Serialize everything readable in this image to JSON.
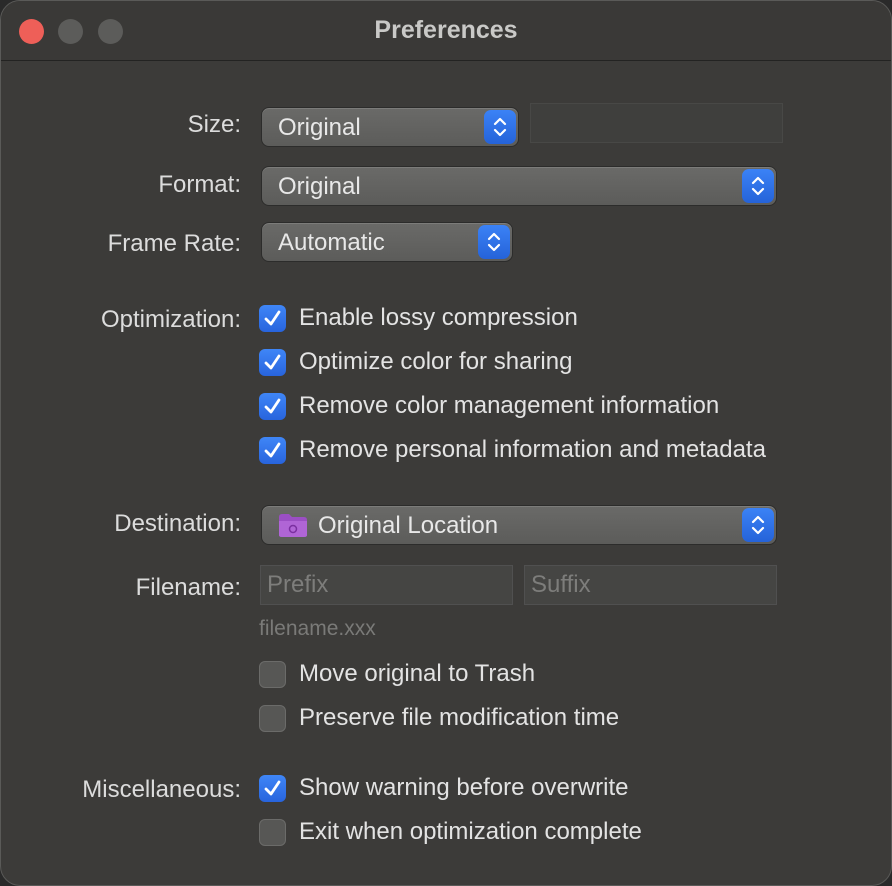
{
  "window": {
    "title": "Preferences"
  },
  "size": {
    "label": "Size:",
    "value": "Original",
    "custom_value": ""
  },
  "format": {
    "label": "Format:",
    "value": "Original"
  },
  "frame_rate": {
    "label": "Frame Rate:",
    "value": "Automatic"
  },
  "optimization": {
    "label": "Optimization:",
    "options": [
      {
        "label": "Enable lossy compression",
        "checked": true
      },
      {
        "label": "Optimize color for sharing",
        "checked": true
      },
      {
        "label": "Remove color management information",
        "checked": true
      },
      {
        "label": "Remove personal information and metadata",
        "checked": true
      }
    ]
  },
  "destination": {
    "label": "Destination:",
    "value": "Original Location",
    "icon": "folder-icon"
  },
  "filename": {
    "label": "Filename:",
    "prefix_placeholder": "Prefix",
    "suffix_placeholder": "Suffix",
    "example": "filename.xxx",
    "options": [
      {
        "label": "Move original to Trash",
        "checked": false
      },
      {
        "label": "Preserve file modification time",
        "checked": false
      }
    ]
  },
  "misc": {
    "label": "Miscellaneous:",
    "options": [
      {
        "label": "Show warning before overwrite",
        "checked": true
      },
      {
        "label": "Exit when optimization complete",
        "checked": false
      }
    ]
  },
  "colors": {
    "accent": "#2f6fe8",
    "close": "#ee5f58",
    "folder": "#8e44ad"
  }
}
